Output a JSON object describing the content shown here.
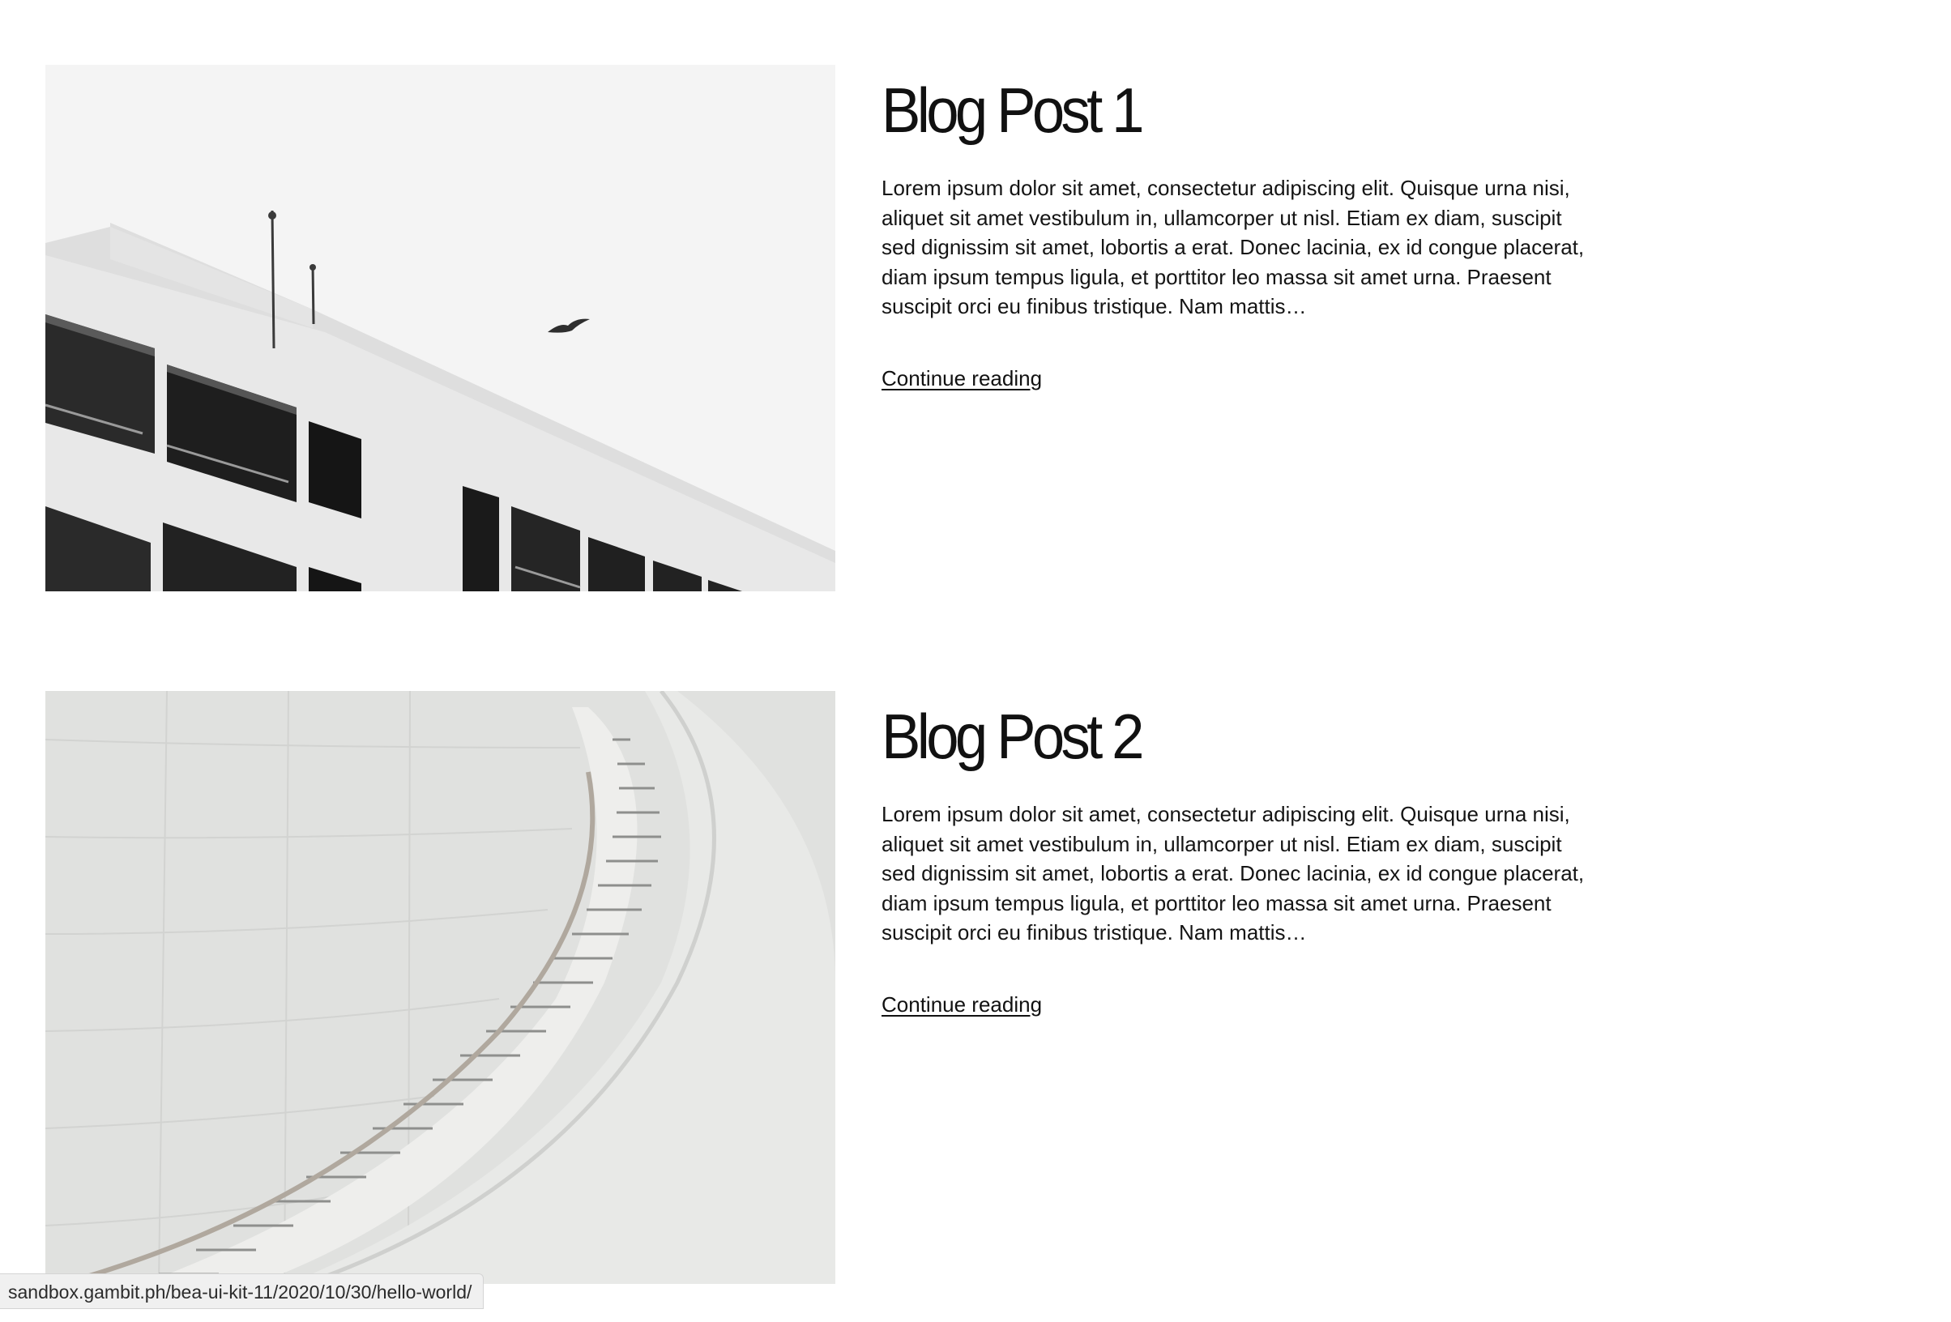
{
  "posts": [
    {
      "title": "Blog Post 1",
      "excerpt": "Lorem ipsum dolor sit amet, consectetur adipiscing elit. Quisque urna nisi, aliquet sit amet vestibulum in, ullamcorper ut nisl. Etiam ex diam, suscipit sed dignissim sit amet, lobortis a erat. Donec lacinia, ex id congue placerat, diam ipsum tempus ligula, et porttitor leo massa sit amet urna. Praesent suscipit orci eu finibus tristique. Nam mattis…",
      "link_label": "Continue reading",
      "image": "building-with-bird"
    },
    {
      "title": "Blog Post 2",
      "excerpt": "Lorem ipsum dolor sit amet, consectetur adipiscing elit. Quisque urna nisi, aliquet sit amet vestibulum in, ullamcorper ut nisl. Etiam ex diam, suscipit sed dignissim sit amet, lobortis a erat. Donec lacinia, ex id congue placerat, diam ipsum tempus ligula, et porttitor leo massa sit amet urna. Praesent suscipit orci eu finibus tristique. Nam mattis…",
      "link_label": "Continue reading",
      "image": "curved-staircase"
    }
  ],
  "status_bar": {
    "url": "sandbox.gambit.ph/bea-ui-kit-11/2020/10/30/hello-world/"
  }
}
